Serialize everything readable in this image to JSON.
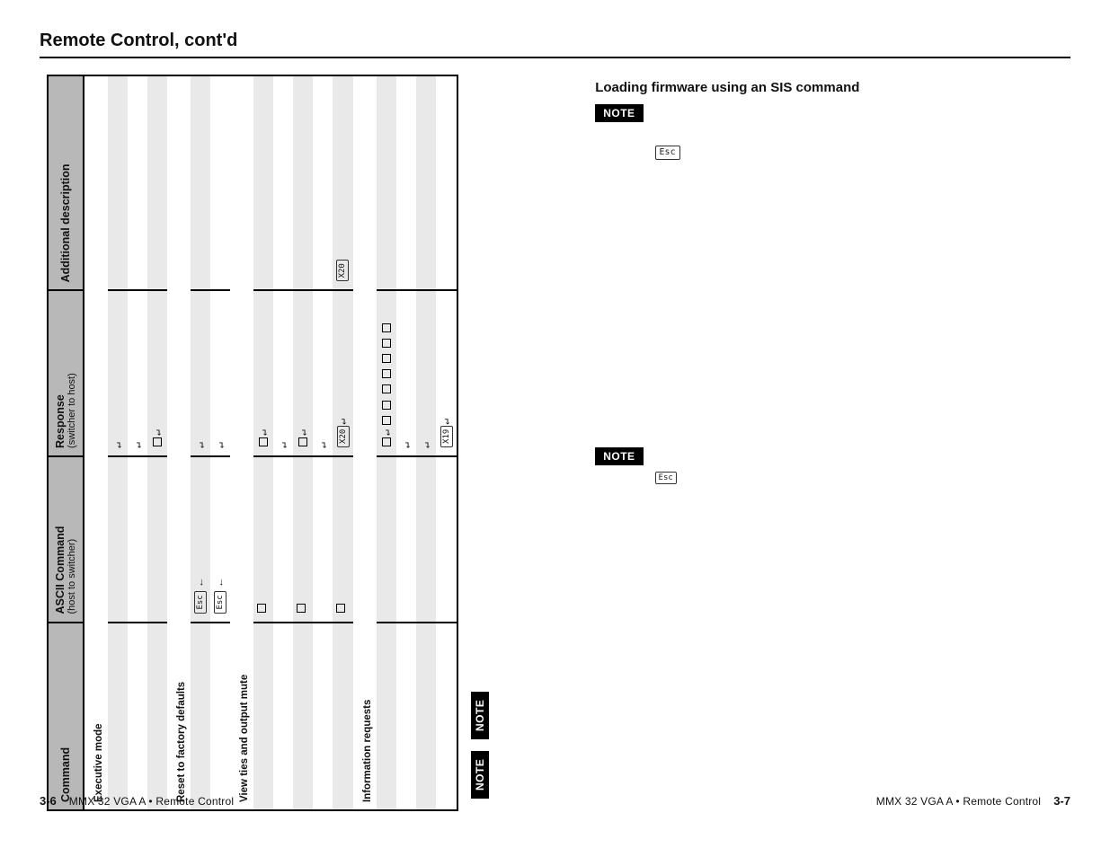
{
  "header": {
    "title": "Remote Control, cont'd"
  },
  "table": {
    "headers": {
      "cmd": "Command",
      "ascii": "ASCII Command",
      "ascii_sub": "(host to switcher)",
      "resp": "Response",
      "resp_sub": "(switcher to host)",
      "desc": "Additional description"
    },
    "sections": [
      {
        "title": "Executive mode",
        "rows": [
          {
            "shade": true,
            "cmd": "",
            "ascii": "",
            "resp": "↵",
            "desc": ""
          },
          {
            "shade": false,
            "cmd": "",
            "ascii": "",
            "resp": "↵",
            "desc": ""
          },
          {
            "shade": true,
            "cmd": "",
            "ascii": "",
            "resp": "□↵",
            "desc": ""
          }
        ]
      },
      {
        "title": "Reset to factory defaults",
        "rows": [
          {
            "shade": true,
            "cmd": "",
            "ascii": "Esc  ←",
            "resp": "↵",
            "desc": ""
          },
          {
            "shade": false,
            "cmd": "",
            "ascii": "Esc  ←",
            "resp": "↵",
            "desc": ""
          }
        ]
      },
      {
        "title": "View ties and output mute",
        "rows": [
          {
            "shade": true,
            "cmd": "",
            "ascii": "□",
            "resp": "□↵",
            "desc": ""
          },
          {
            "shade": false,
            "cmd": "",
            "ascii": "",
            "resp": "↵",
            "desc": ""
          },
          {
            "shade": true,
            "cmd": "",
            "ascii": "□",
            "resp": "□↵",
            "desc": ""
          },
          {
            "shade": false,
            "cmd": "",
            "ascii": "",
            "resp": "↵",
            "desc": ""
          },
          {
            "shade": true,
            "cmd": "",
            "ascii": "□",
            "resp": "X20↵",
            "desc": "X20"
          }
        ]
      },
      {
        "title": "Information requests",
        "rows": [
          {
            "shade": true,
            "cmd": "",
            "ascii": "",
            "resp": "□↵ □ □ □ □ □ □ □",
            "desc": ""
          },
          {
            "shade": false,
            "cmd": "",
            "ascii": "",
            "resp": "↵",
            "desc": ""
          },
          {
            "shade": true,
            "cmd": "",
            "ascii": "",
            "resp": "↵",
            "desc": ""
          },
          {
            "shade": false,
            "cmd": "",
            "ascii": "",
            "resp": "X19↵",
            "desc": ""
          }
        ]
      }
    ]
  },
  "notes": {
    "label": "NOTE"
  },
  "right": {
    "heading": "Loading firmware using an SIS command",
    "esc": "Esc"
  },
  "footer": {
    "book": "MMX 32 VGA A • Remote Control",
    "left_page": "3-6",
    "right_page": "3-7"
  }
}
